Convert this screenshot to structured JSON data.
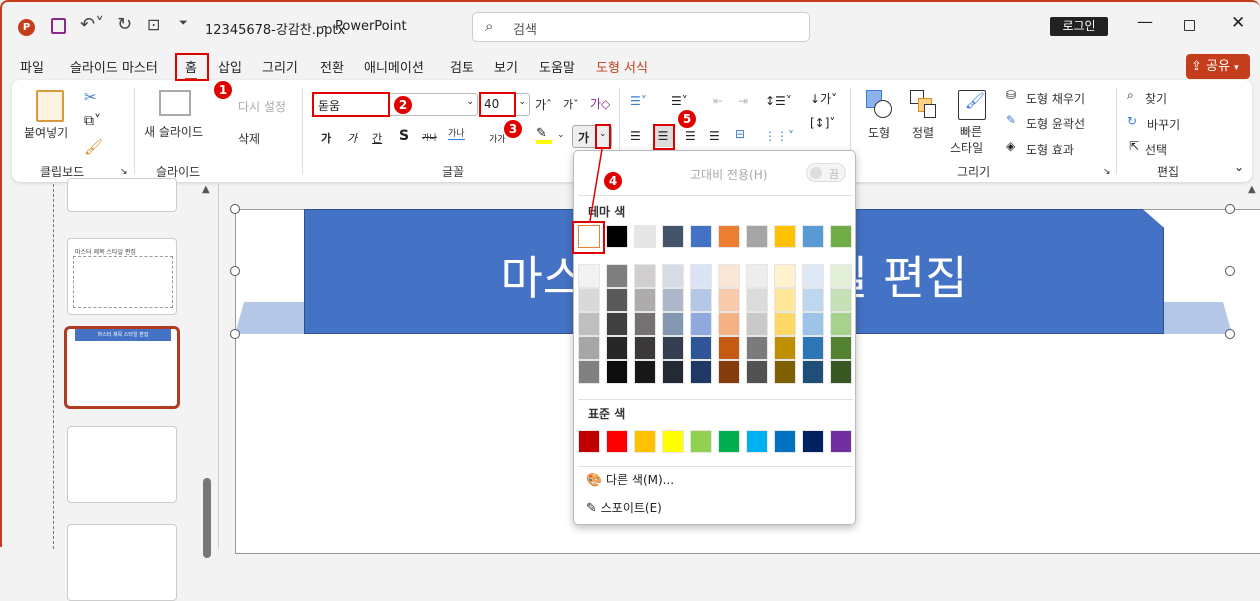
{
  "titlebar": {
    "filename": "12345678-강감찬.pptx",
    "separator": "-",
    "app": "PowerPoint",
    "search_placeholder": "검색",
    "login": "로그인",
    "share": "공유"
  },
  "tabs": [
    "파일",
    "슬라이드 마스터",
    "홈",
    "삽입",
    "그리기",
    "전환",
    "애니메이션",
    "검토",
    "보기",
    "도움말",
    "도형 서식"
  ],
  "active_tab": "홈",
  "ribbon": {
    "clipboard": {
      "paste": "붙여넣기",
      "label": "클립보드"
    },
    "slides": {
      "new_slide": "새 슬라이드",
      "reset": "다시 설정",
      "delete": "삭제",
      "label": "슬라이드"
    },
    "font": {
      "font_name": "돋움",
      "font_size": "40",
      "bold": "가",
      "italic": "가",
      "underline": "간",
      "shadow": "S",
      "strike": "가나",
      "spacing": "가나",
      "case": "가가",
      "font_color": "가",
      "label": "글꼴"
    },
    "drawing": {
      "shapes": "도형",
      "arrange": "정렬",
      "quick_styles_1": "빠른",
      "quick_styles_2": "스타일",
      "fill": "도형 채우기",
      "outline": "도형 윤곽선",
      "effects": "도형 효과",
      "label": "그리기"
    },
    "editing": {
      "find": "찾기",
      "replace": "바꾸기",
      "select": "선택",
      "label": "편집"
    }
  },
  "markers": [
    "1",
    "2",
    "3",
    "4",
    "5"
  ],
  "color_menu": {
    "high_contrast": "고대비 전용(H)",
    "toggle": "끔",
    "theme_title": "테마 색",
    "theme_colors": [
      "#FFFFFF",
      "#000000",
      "#E7E6E6",
      "#44546A",
      "#4472C4",
      "#ED7D31",
      "#A5A5A5",
      "#FFC000",
      "#5B9BD5",
      "#70AD47"
    ],
    "shades": [
      [
        "#F2F2F2",
        "#7F7F7F",
        "#D0CECE",
        "#D6DCE4",
        "#DAE3F3",
        "#FBE5D6",
        "#EDEDED",
        "#FFF2CC",
        "#DEEBF7",
        "#E2F0D9"
      ],
      [
        "#D9D9D9",
        "#595959",
        "#AEABAB",
        "#ADB9CA",
        "#B4C7E7",
        "#F8CBAD",
        "#DBDBDB",
        "#FFE699",
        "#BDD7EE",
        "#C5E0B4"
      ],
      [
        "#BFBFBF",
        "#404040",
        "#757171",
        "#8497B0",
        "#8FAADC",
        "#F4B183",
        "#C9C9C9",
        "#FFD966",
        "#9DC3E6",
        "#A9D18E"
      ],
      [
        "#A6A6A6",
        "#262626",
        "#3B3838",
        "#333F50",
        "#2F5597",
        "#C55A11",
        "#7B7B7B",
        "#BF9000",
        "#2E75B6",
        "#548235"
      ],
      [
        "#808080",
        "#0D0D0D",
        "#171717",
        "#222A35",
        "#203864",
        "#843C0C",
        "#525252",
        "#7F6000",
        "#1F4E79",
        "#385723"
      ]
    ],
    "standard_title": "표준 색",
    "standard_colors": [
      "#C00000",
      "#FF0000",
      "#FFC000",
      "#FFFF00",
      "#92D050",
      "#00B050",
      "#00B0F0",
      "#0070C0",
      "#002060",
      "#7030A0"
    ],
    "more_colors": "다른 색(M)...",
    "eyedropper": "스포이트(E)"
  },
  "slide": {
    "title": "마스터 제목 스타일 편집",
    "thumb_title": "마스터 제목 스타일 편집",
    "title_color": "#4472C4"
  },
  "colors": {
    "accent": "#C43E1C",
    "annotation": "#E00000"
  }
}
